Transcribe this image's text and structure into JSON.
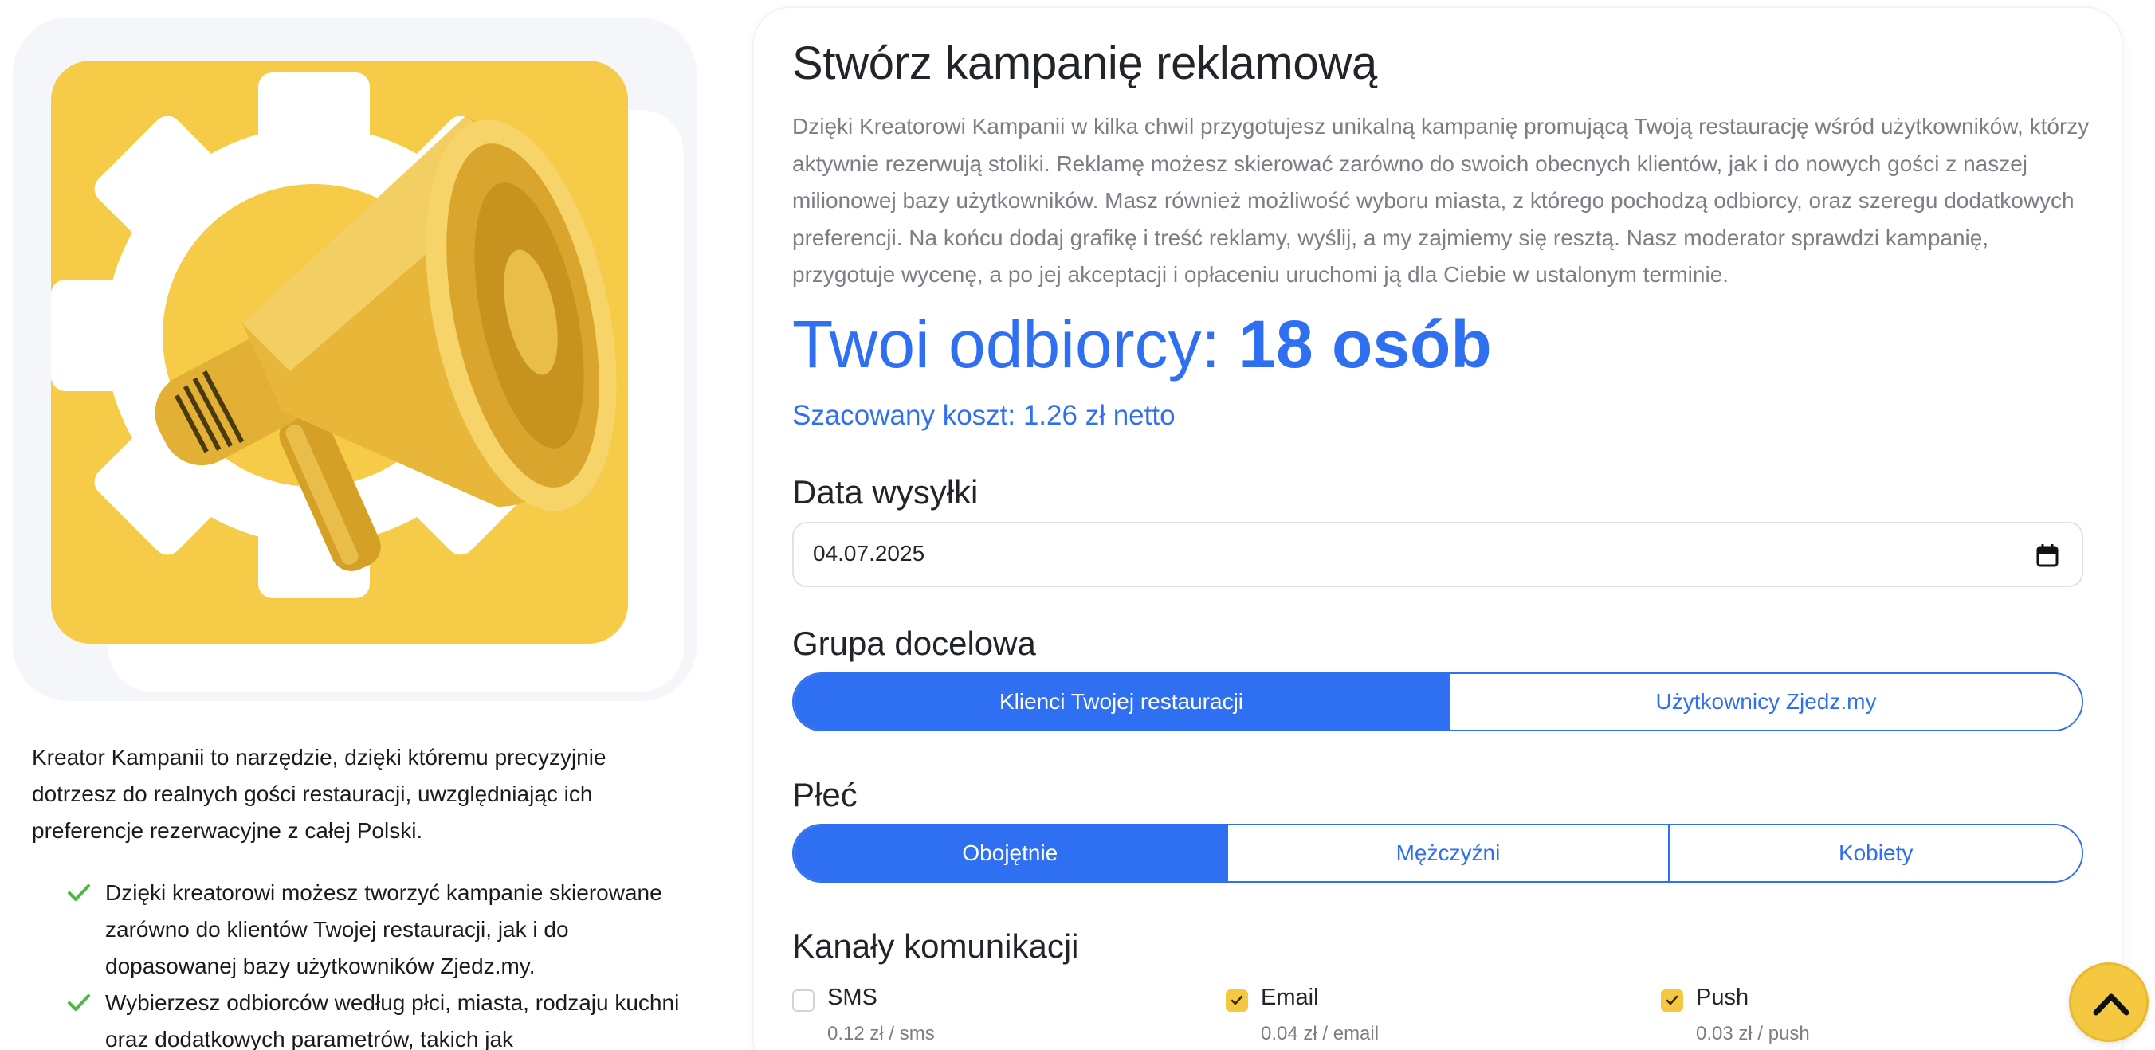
{
  "left": {
    "intro": "Kreator Kampanii to narzędzie, dzięki któremu precyzyjnie dotrzesz do realnych gości restauracji, uwzględniając ich preferencje rezerwacyjne z całej Polski.",
    "features": [
      "Dzięki kreatorowi możesz tworzyć kampanie skierowane zarówno do klientów Twojej restauracji, jak i do dopasowanej bazy użytkowników Zjedz.my.",
      "Wybierzesz odbiorców według płci, miasta, rodzaju kuchni oraz dodatkowych parametrów, takich jak"
    ]
  },
  "main": {
    "title": "Stwórz kampanię reklamową",
    "description": "Dzięki Kreatorowi Kampanii w kilka chwil przygotujesz unikalną kampanię promującą Twoją restaurację wśród użytkowników, którzy aktywnie rezerwują stoliki. Reklamę możesz skierować zarówno do swoich obecnych klientów, jak i do nowych gości z naszej milionowej bazy użytkowników. Masz również możliwość wyboru miasta, z którego pochodzą odbiorcy, oraz szeregu dodatkowych preferencji. Na końcu dodaj grafikę i treść reklamy, wyślij, a my zajmiemy się resztą. Nasz moderator sprawdzi kampanię, przygotuje wycenę, a po jej akceptacji i opłaceniu uruchomi ją dla Ciebie w ustalonym terminie.",
    "recipients_label": "Twoi odbiorcy: ",
    "recipients_value": "18 osób",
    "cost": "Szacowany koszt: 1.26 zł netto",
    "date": {
      "label": "Data wysyłki",
      "value": "04.07.2025"
    },
    "target_group": {
      "label": "Grupa docelowa",
      "options": [
        "Klienci Twojej restauracji",
        "Użytkownicy Zjedz.my"
      ],
      "selected": "Klienci Twojej restauracji"
    },
    "gender": {
      "label": "Płeć",
      "options": [
        "Obojętnie",
        "Mężczyźni",
        "Kobiety"
      ],
      "selected": "Obojętnie"
    },
    "channels": {
      "label": "Kanały komunikacji",
      "items": [
        {
          "name": "SMS",
          "price": "0.12 zł / sms",
          "checked": false
        },
        {
          "name": "Email",
          "price": "0.04 zł / email",
          "checked": true
        },
        {
          "name": "Push",
          "price": "0.03 zł / push",
          "checked": true
        }
      ]
    }
  },
  "colors": {
    "primary": "#2f6ff1",
    "accent_yellow": "#f5c842",
    "check_green": "#4cb944",
    "muted_text": "#7b7f85"
  },
  "icons": {
    "hero": "megaphone-icon",
    "date": "calendar-icon",
    "feature": "check-icon",
    "scroll_top": "chevron-up-icon"
  }
}
